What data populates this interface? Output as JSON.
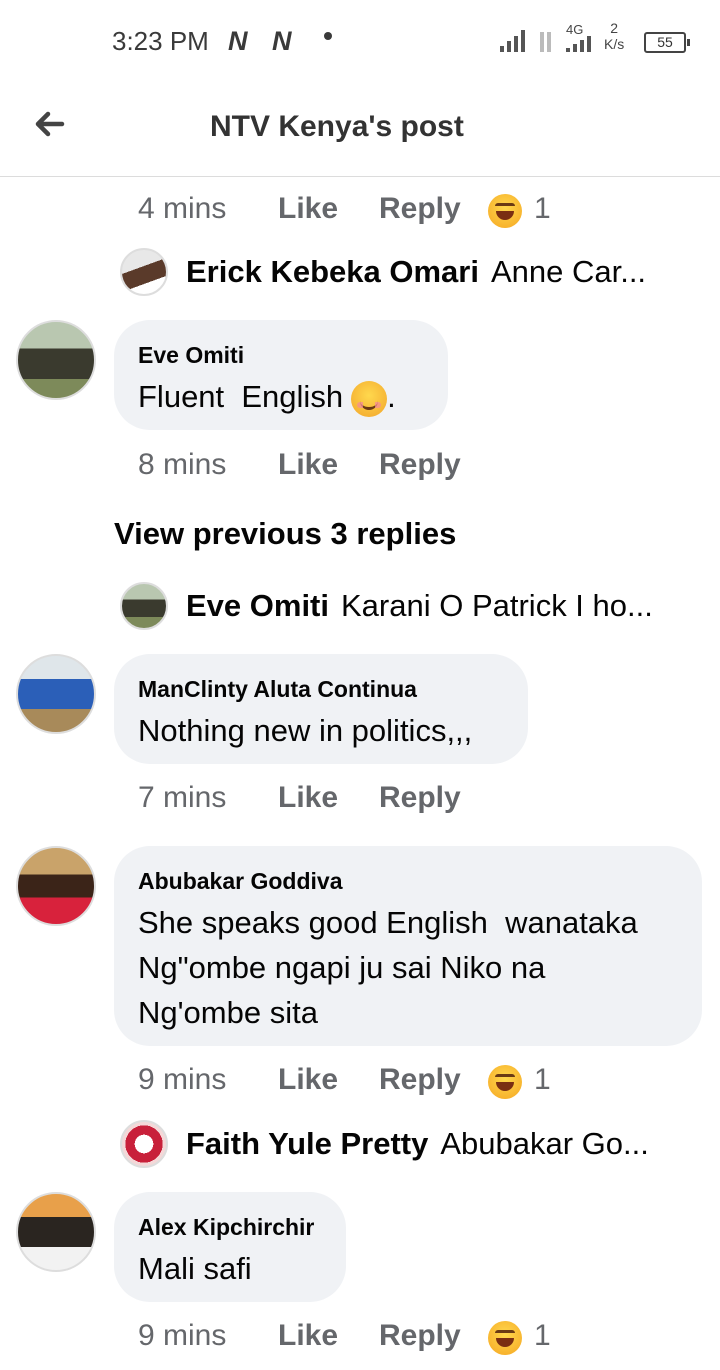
{
  "status_bar": {
    "time": "3:23 PM",
    "notif1": "N",
    "notif2": "N",
    "network": "4G",
    "speed_value": "2",
    "speed_unit": "K/s",
    "battery": "55"
  },
  "header": {
    "title": "NTV Kenya's post",
    "back_icon": "arrow-left-icon"
  },
  "comments": [
    {
      "meta": {
        "time": "4 mins",
        "like": "Like",
        "reply": "Reply",
        "reaction_count": "1"
      },
      "reply_preview": {
        "name": "Erick Kebeka Omari",
        "snippet": "Anne Car..."
      }
    },
    {
      "author": "Eve Omiti",
      "text": "Fluent  English",
      "text_suffix": ".",
      "meta": {
        "time": "8 mins",
        "like": "Like",
        "reply": "Reply"
      },
      "view_previous": "View previous 3 replies",
      "reply_preview": {
        "name": "Eve Omiti",
        "snippet": "Karani O Patrick I ho..."
      }
    },
    {
      "author": "ManClinty Aluta Continua",
      "text": "Nothing new in politics,,,",
      "meta": {
        "time": "7 mins",
        "like": "Like",
        "reply": "Reply"
      }
    },
    {
      "author": "Abubakar Goddiva",
      "text": "She speaks good English  wanataka Ng\"ombe ngapi ju sai Niko na Ng'ombe sita",
      "meta": {
        "time": "9 mins",
        "like": "Like",
        "reply": "Reply",
        "reaction_count": "1"
      },
      "reply_preview": {
        "name": "Faith Yule Pretty",
        "snippet": "Abubakar Go..."
      }
    },
    {
      "author": "Alex Kipchirchir",
      "text": "Mali safi",
      "meta": {
        "time": "9 mins",
        "like": "Like",
        "reply": "Reply",
        "reaction_count": "1"
      }
    }
  ],
  "colors": {
    "bubble": "#f0f2f5",
    "meta_text": "#65676b",
    "text": "#050505"
  }
}
